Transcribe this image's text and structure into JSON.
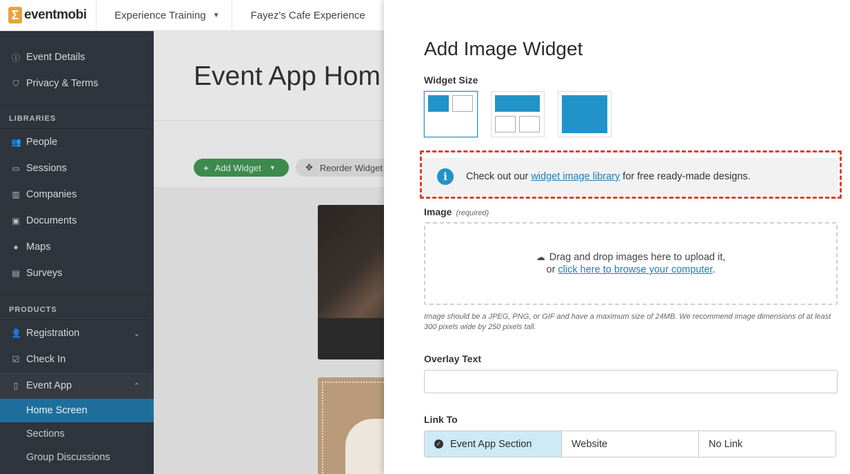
{
  "topbar": {
    "brand": "eventmobi",
    "breadcrumbs": [
      {
        "label": "Experience Training",
        "has_dropdown": true
      },
      {
        "label": "Fayez's Cafe Experience",
        "has_dropdown": false
      }
    ]
  },
  "sidebar": {
    "top_items": [
      {
        "label": "Event Details",
        "icon": "info-circle-icon"
      },
      {
        "label": "Privacy & Terms",
        "icon": "shield-icon"
      }
    ],
    "libraries_heading": "LIBRARIES",
    "libraries": [
      {
        "label": "People",
        "icon": "users-icon"
      },
      {
        "label": "Sessions",
        "icon": "calendar-icon"
      },
      {
        "label": "Companies",
        "icon": "building-icon"
      },
      {
        "label": "Documents",
        "icon": "briefcase-icon"
      },
      {
        "label": "Maps",
        "icon": "map-pin-icon"
      },
      {
        "label": "Surveys",
        "icon": "clipboard-icon"
      }
    ],
    "products_heading": "PRODUCTS",
    "products": [
      {
        "label": "Registration",
        "icon": "user-plus-icon",
        "chevron": "down"
      },
      {
        "label": "Check In",
        "icon": "check-square-icon"
      },
      {
        "label": "Event App",
        "icon": "mobile-icon",
        "chevron": "up"
      }
    ],
    "event_app_sub": [
      {
        "label": "Home Screen",
        "active": true
      },
      {
        "label": "Sections",
        "active": false
      },
      {
        "label": "Group Discussions",
        "active": false
      }
    ]
  },
  "main": {
    "title": "Event App Hom",
    "add_widget_label": "Add Widget",
    "reorder_label": "Reorder Widget"
  },
  "drawer": {
    "title": "Add Image Widget",
    "widget_size_label": "Widget Size",
    "info": {
      "prefix": "Check out our ",
      "link": "widget image library",
      "suffix": " for free ready-made designs."
    },
    "image_label": "Image",
    "image_required": "(required)",
    "dropzone_line1": "Drag and drop images here to upload it,",
    "dropzone_or": "or ",
    "dropzone_link": "click here to browse your computer",
    "dropzone_period": ".",
    "hint": "Image should be a JPEG, PNG, or GIF and have a maximum size of 24MB. We recommend image dimensions of at least 300 pixels wide by 250 pixels tall.",
    "overlay_label": "Overlay Text",
    "overlay_value": "",
    "link_to_label": "Link To",
    "link_options": [
      "Event App Section",
      "Website",
      "No Link"
    ],
    "link_selected": "Event App Section"
  },
  "colors": {
    "accent": "#2193c8",
    "sidebar_bg": "#2f353d",
    "active_nav": "#1f6f9c",
    "highlight_dash": "#e03c2c",
    "add_button": "#3c8a4c"
  }
}
